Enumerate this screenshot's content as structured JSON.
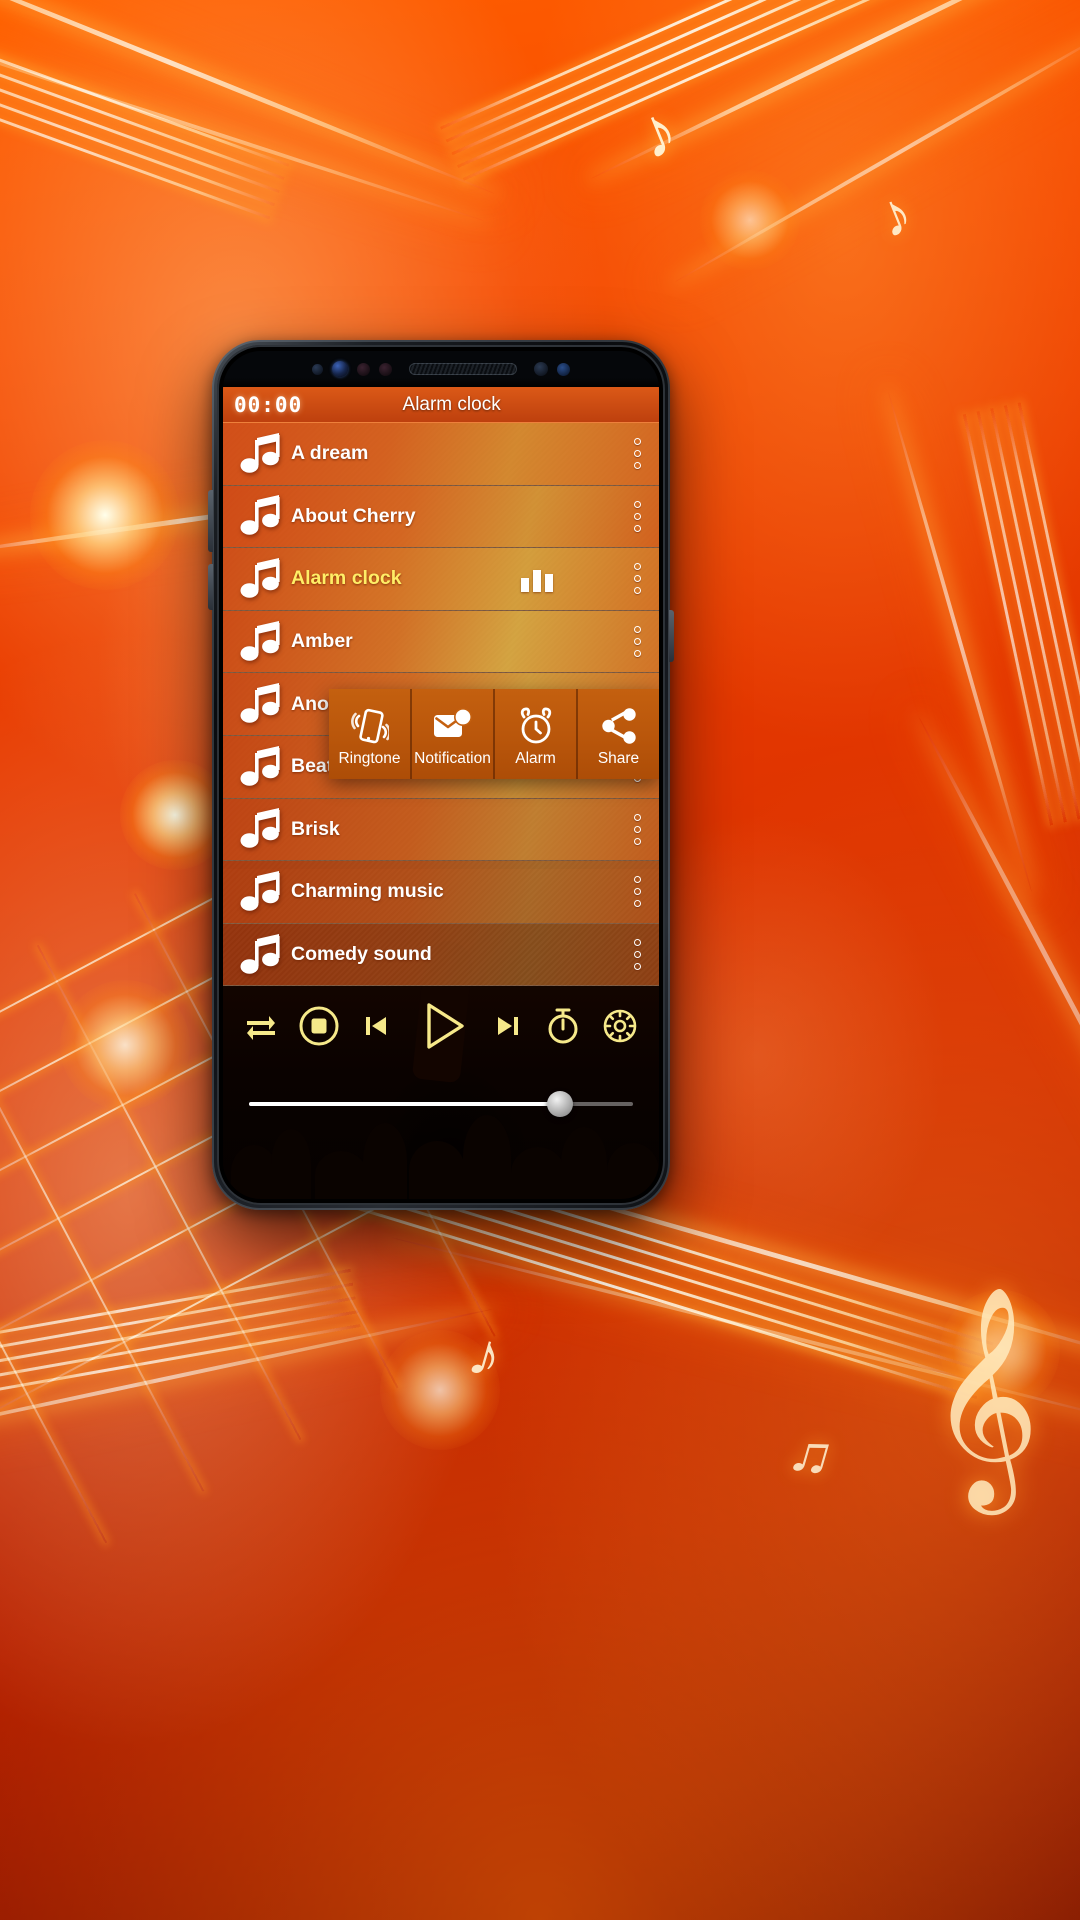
{
  "background": {
    "theme_name": "orange-music-notes-wallpaper",
    "accent_color": "#e2601a",
    "highlight_color": "#ffee66"
  },
  "statusbar": {
    "clock": "00:00",
    "title": "Alarm clock"
  },
  "list": {
    "note_icon": "music-note-icon",
    "overflow_icon": "more-options-dots-icon",
    "equalizer_icon": "equalizer-bars-icon",
    "items": [
      {
        "label": "A dream",
        "selected": false
      },
      {
        "label": "About Cherry",
        "selected": false
      },
      {
        "label": "Alarm clock",
        "selected": true
      },
      {
        "label": "Amber",
        "selected": false
      },
      {
        "label": "Another",
        "selected": false
      },
      {
        "label": "Beat",
        "selected": false
      },
      {
        "label": "Brisk",
        "selected": false
      },
      {
        "label": "Charming music",
        "selected": false
      },
      {
        "label": "Comedy sound",
        "selected": false
      }
    ]
  },
  "popup": {
    "items": [
      {
        "label": "Ringtone",
        "icon": "phone-vibrate-icon"
      },
      {
        "label": "Notification",
        "icon": "notification-message-icon"
      },
      {
        "label": "Alarm",
        "icon": "alarm-clock-icon"
      },
      {
        "label": "Share",
        "icon": "share-icon"
      }
    ]
  },
  "controls": {
    "buttons": [
      {
        "name": "repeat",
        "icon": "repeat-icon"
      },
      {
        "name": "stop",
        "icon": "stop-circle-icon"
      },
      {
        "name": "previous",
        "icon": "skip-previous-icon"
      },
      {
        "name": "play",
        "icon": "play-icon"
      },
      {
        "name": "next",
        "icon": "skip-next-icon"
      },
      {
        "name": "timer",
        "icon": "timer-icon"
      },
      {
        "name": "settings",
        "icon": "gear-icon"
      }
    ]
  },
  "seekbar": {
    "progress_percent": 81,
    "name": "playback-seek-slider"
  }
}
